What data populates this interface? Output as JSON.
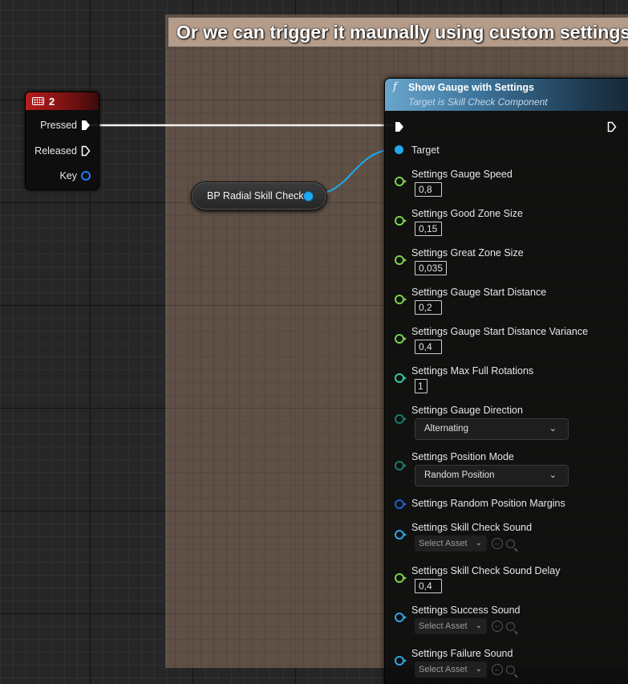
{
  "comment": {
    "text": "Or we can trigger it maunally using custom settings."
  },
  "key_node": {
    "title": "2",
    "pins": [
      {
        "label": "Pressed"
      },
      {
        "label": "Released"
      },
      {
        "label": "Key"
      }
    ]
  },
  "var_node": {
    "label": "BP Radial Skill Check"
  },
  "func_node": {
    "title": "Show Gauge with Settings",
    "subtitle": "Target is Skill Check Component",
    "target_label": "Target",
    "params": [
      {
        "label": "Settings Gauge Speed",
        "value": "0,8",
        "kind": "float",
        "color": "#7ad34a"
      },
      {
        "label": "Settings Good Zone Size",
        "value": "0,15",
        "kind": "float",
        "color": "#7ad34a"
      },
      {
        "label": "Settings Great Zone Size",
        "value": "0,035",
        "kind": "float",
        "color": "#7ad34a"
      },
      {
        "label": "Settings Gauge Start Distance",
        "value": "0,2",
        "kind": "float",
        "color": "#7ad34a"
      },
      {
        "label": "Settings Gauge Start Distance Variance",
        "value": "0,4",
        "kind": "float",
        "color": "#7ad34a"
      },
      {
        "label": "Settings Max Full Rotations",
        "value": "1",
        "kind": "int",
        "color": "#2fc9a4"
      },
      {
        "label": "Settings Gauge Direction",
        "value": "Alternating",
        "kind": "enum",
        "color": "#1a7a6a"
      },
      {
        "label": "Settings Position Mode",
        "value": "Random Position",
        "kind": "enum",
        "color": "#1a7a6a"
      },
      {
        "label": "Settings Random Position Margins",
        "value": "",
        "kind": "struct",
        "color": "#1c5fd0"
      },
      {
        "label": "Settings Skill Check Sound",
        "value": "Select Asset",
        "kind": "asset",
        "color": "#2aa8e0"
      },
      {
        "label": "Settings Skill Check Sound Delay",
        "value": "0,4",
        "kind": "float",
        "color": "#7ad34a"
      },
      {
        "label": "Settings Success Sound",
        "value": "Select Asset",
        "kind": "asset",
        "color": "#2aa8e0"
      },
      {
        "label": "Settings Failure Sound",
        "value": "Select Asset",
        "kind": "asset",
        "color": "#2aa8e0"
      }
    ]
  }
}
